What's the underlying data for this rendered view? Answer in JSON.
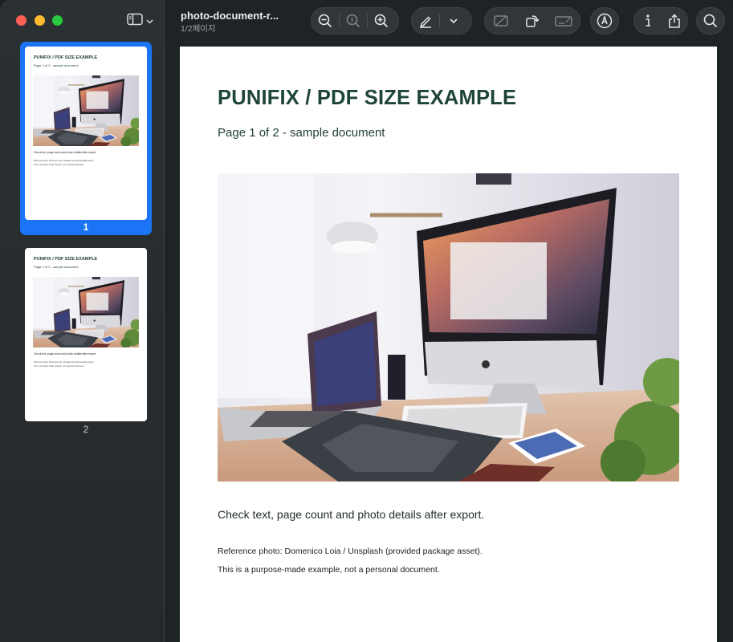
{
  "toolbar": {
    "title": "photo-document-r...",
    "subtitle": "1/2페이지"
  },
  "document": {
    "title": "PUNIFIX / PDF SIZE EXAMPLE",
    "subtitle": "Page 1 of 2 - sample document",
    "check_text": "Check text, page count and photo details after export.",
    "reference": "Reference photo: Domenico Loia / Unsplash (provided package asset).",
    "note": "This is a purpose-made example, not a personal document."
  },
  "thumbnails": [
    {
      "label": "1",
      "selected": true,
      "title": "PUNIFIX / PDF SIZE EXAMPLE",
      "subtitle": "Page 1 of 2 - sample document",
      "check_text": "Check text, page count and photo details after export",
      "reference": "Reference photo: Domenico Loia / Unsplash (provided package asset)",
      "note": "This is a purpose-made example, not a personal document."
    },
    {
      "label": "2",
      "selected": false,
      "title": "PUNIFIX / PDF SIZE EXAMPLE",
      "subtitle": "Page 2 of 2 - sample document",
      "check_text": "Check text, page count and photo details after export",
      "reference": "Reference photo: Domenico Loia / Unsplash (provided package asset)",
      "note": "This is a purpose-made example, not a personal document."
    }
  ],
  "icons": [
    "sidebar-icon",
    "zoom-out-icon",
    "actual-size-icon",
    "zoom-in-icon",
    "highlight-pen-icon",
    "chevron-down-icon",
    "crop-icon",
    "rotate-icon",
    "redact-icon",
    "markup-icon",
    "info-icon",
    "share-icon",
    "search-icon"
  ],
  "colors": {
    "accent": "#1a74f5",
    "doc_title": "#1f4538",
    "window_bg": "#1e2326"
  }
}
